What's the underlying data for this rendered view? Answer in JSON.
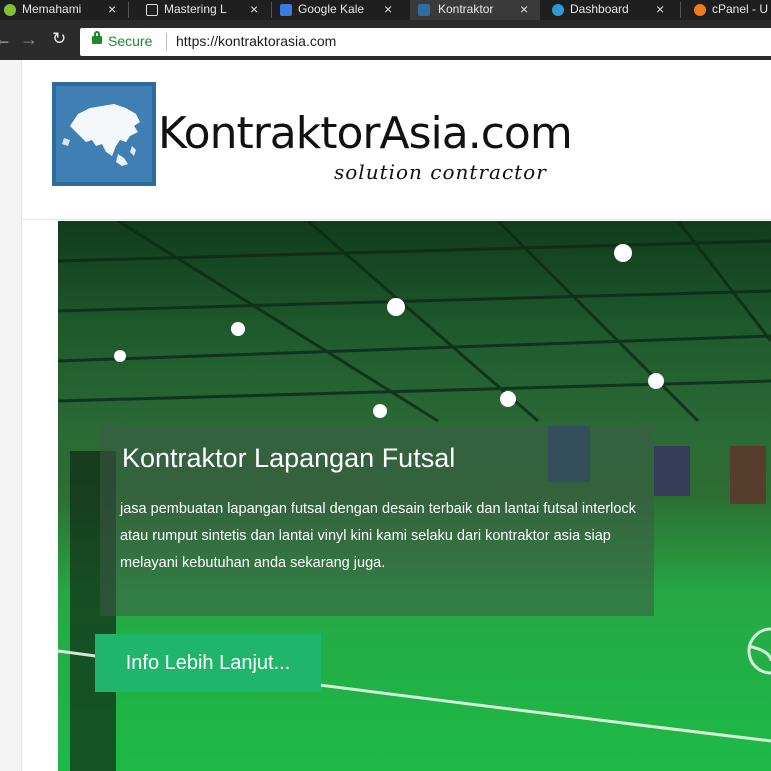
{
  "browser": {
    "tabs": [
      {
        "title": "Memahami",
        "color": "#7fbf3a"
      },
      {
        "title": "Mastering L",
        "color": "#dcdcdc"
      },
      {
        "title": "Google Kale",
        "color": "#3b7be0"
      },
      {
        "title": "Kontraktor",
        "color": "#2e6da4"
      },
      {
        "title": "Dashboard",
        "color": "#2b9bd3"
      },
      {
        "title": "cPanel - U",
        "color": "#f07b1e"
      }
    ],
    "close_glyph": "×",
    "secure_label": "Secure",
    "url": "https://kontraktorasia.com"
  },
  "site": {
    "brand": "KontraktorAsia.com",
    "tagline": "solution contractor"
  },
  "hero": {
    "title": "Kontraktor Lapangan Futsal",
    "description": "jasa pembuatan lapangan futsal dengan desain terbaik dan lantai futsal interlock atau rumput sintetis dan lantai vinyl kini kami selaku dari kontraktor asia siap melayani kebutuhan anda sekarang juga.",
    "cta_label": "Info Lebih Lanjut..."
  },
  "icons": {
    "back": "arrow-left-icon",
    "forward": "arrow-right-icon",
    "reload": "reload-icon",
    "lock": "lock-icon"
  },
  "colors": {
    "accent_green": "#1fb56a",
    "secure_green": "#1a8a2b",
    "logo_blue": "#3f7fb3"
  }
}
